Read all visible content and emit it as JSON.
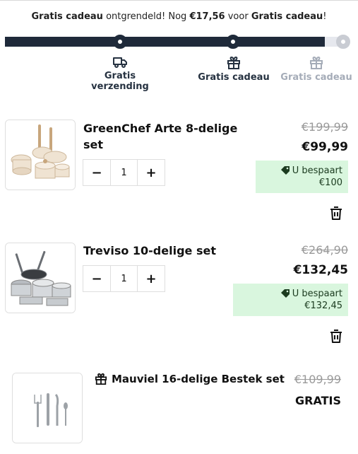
{
  "banner": {
    "part1": "Gratis cadeau",
    "part2": " ontgrendeld! Nog ",
    "part3": "€17,56",
    "part4": " voor ",
    "part5": "Gratis cadeau",
    "part6": "!"
  },
  "progress": {
    "fraction": 0.93,
    "milestones": [
      {
        "line1": "Gratis",
        "line2": "verzending",
        "icon": "truck-icon",
        "state": "done"
      },
      {
        "line1": "Gratis cadeau",
        "icon": "gift-icon",
        "state": "done"
      },
      {
        "line1": "Gratis cadeau",
        "icon": "gift-icon",
        "state": "todo"
      }
    ]
  },
  "cart": {
    "items": [
      {
        "title_line1": "GreenChef Arte 8-delige",
        "title_line2": "set",
        "old_price": "€199,99",
        "price": "€99,99",
        "save_label": "U bespaart",
        "save_amount": "€100",
        "qty": "1",
        "minus": "−",
        "plus": "+"
      },
      {
        "title_line1": "Treviso 10-delige set",
        "old_price": "€264,90",
        "price": "€132,45",
        "save_label": "U bespaart",
        "save_amount": "€132,45",
        "qty": "1",
        "minus": "−",
        "plus": "+"
      }
    ],
    "gift": {
      "title": "Mauviel 16-delige Bestek set",
      "old_price": "€109,99",
      "price": "GRATIS"
    }
  },
  "colors": {
    "progress_fill": "#1f2a3a",
    "progress_track": "#e6e8ee",
    "savings_bg": "#d9f6de"
  }
}
